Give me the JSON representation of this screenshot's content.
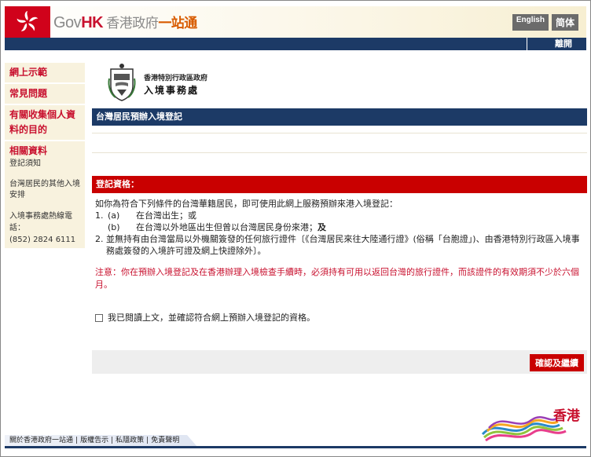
{
  "header": {
    "logo_gov": "Gov",
    "logo_hk": "HK",
    "logo_zh1": " 香港政府",
    "logo_zh2": "一站通",
    "lang_english": "English",
    "lang_simplified": "简体",
    "exit": "離開"
  },
  "sidebar": {
    "items": [
      {
        "label": "網上示範"
      },
      {
        "label": "常見問題"
      },
      {
        "label": "有關收集個人資料的目的"
      },
      {
        "label": "相關資料"
      }
    ],
    "sub_links": [
      "登記須知",
      "台灣居民的其他入境安排"
    ],
    "hotline_label": "入境事務處熱線電話：",
    "hotline_number": "(852) 2824 6111"
  },
  "department": {
    "name_line1": "香港特別行政區政府",
    "name_line2": "入境事務處"
  },
  "page": {
    "title": "台灣居民預辦入境登記",
    "eligibility_header": "登記資格：",
    "intro": "如你為符合下列條件的台灣華籍居民，即可使用此網上服務預辦來港入境登記：",
    "cond1_num": "1.",
    "cond1a_label": "(a)",
    "cond1a_text": "在台灣出生；或",
    "cond1b_label": "(b)",
    "cond1b_text": "在台灣以外地區出生但曾以台灣居民身份來港；",
    "cond1b_and": "及",
    "cond2_num": "2.",
    "cond2_text": "並無持有由台灣當局以外機關簽發的任何旅行證件〔《台灣居民來往大陸通行證》(俗稱「台胞證」)、由香港特別行政區入境事務處簽發的入境許可證及網上快證除外〕。",
    "warning": "注意：你在預辦入境登記及在香港辦理入境檢查手續時，必須持有可用以返回台灣的旅行證件，而該證件的有效期須不少於六個月。",
    "checkbox_label": "我已閱讀上文，並確認符合網上預辦入境登記的資格。",
    "confirm_button": "確認及繼續"
  },
  "brand": {
    "text": "香港"
  },
  "footer": {
    "links": [
      "關於香港政府一站通",
      "版權告示",
      "私隱政策",
      "免責聲明"
    ]
  },
  "colors": {
    "navy": "#1c3a66",
    "red": "#c90000",
    "accent_red": "#c8102e"
  }
}
